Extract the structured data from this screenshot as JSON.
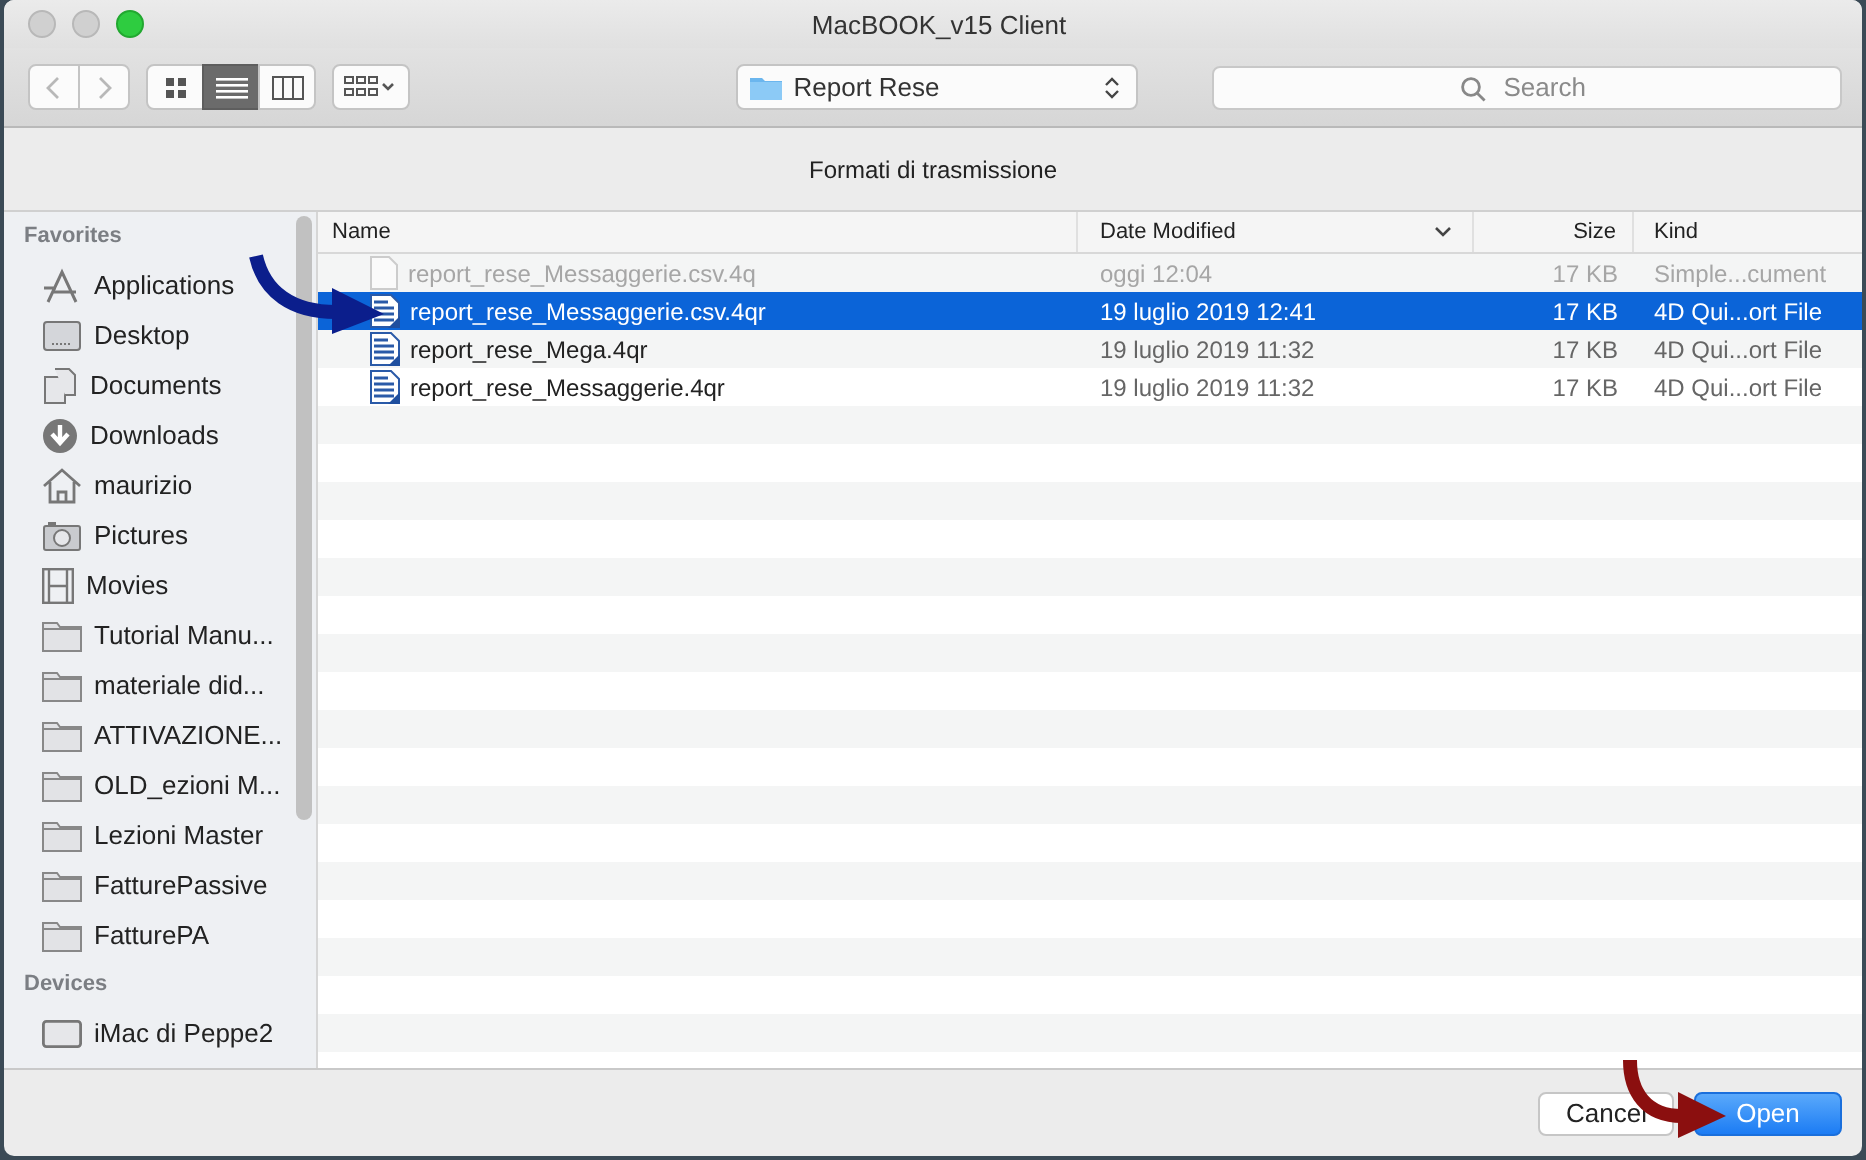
{
  "window": {
    "title": "MacBOOK_v15 Client"
  },
  "toolbar": {
    "view_buttons": [
      {
        "kind": "icon",
        "selected": false
      },
      {
        "kind": "list",
        "selected": true
      },
      {
        "kind": "column",
        "selected": false
      }
    ],
    "location": "Report Rese",
    "search": {
      "placeholder": "Search"
    }
  },
  "message": "Formati di trasmissione",
  "sidebar": {
    "sections": [
      {
        "title": "Favorites",
        "items": [
          {
            "label": "Applications",
            "kind": "apps"
          },
          {
            "label": "Desktop",
            "kind": "desktop"
          },
          {
            "label": "Documents",
            "kind": "documents"
          },
          {
            "label": "Downloads",
            "kind": "downloads"
          },
          {
            "label": "maurizio",
            "kind": "home"
          },
          {
            "label": "Pictures",
            "kind": "pictures"
          },
          {
            "label": "Movies",
            "kind": "movies"
          },
          {
            "label": "Tutorial Manu...",
            "kind": "folder"
          },
          {
            "label": "materiale did...",
            "kind": "folder"
          },
          {
            "label": "ATTIVAZIONE...",
            "kind": "folder"
          },
          {
            "label": "OLD_ezioni M...",
            "kind": "folder"
          },
          {
            "label": "Lezioni Master",
            "kind": "folder"
          },
          {
            "label": "FatturePassive",
            "kind": "folder"
          },
          {
            "label": "FatturePA",
            "kind": "folder"
          }
        ]
      },
      {
        "title": "Devices",
        "items": [
          {
            "label": "iMac di Peppe2",
            "kind": "computer"
          }
        ]
      }
    ]
  },
  "table": {
    "columns": [
      "Name",
      "Date Modified",
      "Size",
      "Kind"
    ],
    "rows": [
      {
        "name": "report_rese_Messaggerie.csv.4q",
        "date": "oggi 12:04",
        "size": "17 KB",
        "kind": "Simple...cument",
        "disabled": true,
        "selected": false
      },
      {
        "name": "report_rese_Messaggerie.csv.4qr",
        "date": "19 luglio 2019 12:41",
        "size": "17 KB",
        "kind": "4D Qui...ort File",
        "disabled": false,
        "selected": true
      },
      {
        "name": "report_rese_Mega.4qr",
        "date": "19 luglio 2019 11:32",
        "size": "17 KB",
        "kind": "4D Qui...ort File",
        "disabled": false,
        "selected": false
      },
      {
        "name": "report_rese_Messaggerie.4qr",
        "date": "19 luglio 2019 11:32",
        "size": "17 KB",
        "kind": "4D Qui...ort File",
        "disabled": false,
        "selected": false
      }
    ]
  },
  "buttons": {
    "cancel": "Cancel",
    "open": "Open"
  }
}
